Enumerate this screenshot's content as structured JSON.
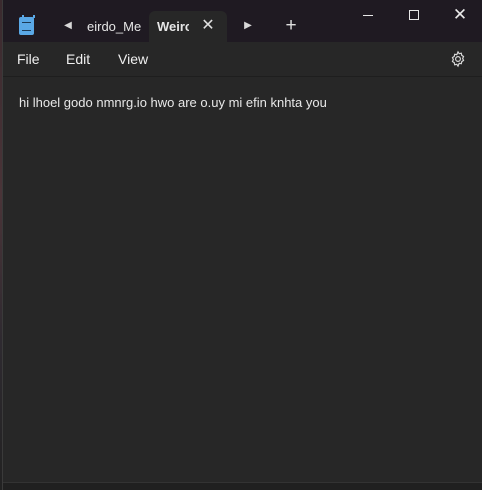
{
  "app": {
    "icon": "notepad-icon"
  },
  "tabs": [
    {
      "title": "eirdo_Me",
      "active": false
    },
    {
      "title": "Weirc",
      "active": true
    }
  ],
  "tab_controls": {
    "scroll_left_icon": "caret-left-icon",
    "scroll_right_icon": "caret-right-icon",
    "close_icon": "close-icon",
    "new_tab_icon": "plus-icon"
  },
  "window_controls": {
    "minimize_icon": "minimize-icon",
    "maximize_icon": "maximize-icon",
    "close_icon": "close-icon"
  },
  "menu": {
    "file": "File",
    "edit": "Edit",
    "view": "View",
    "settings_icon": "gear-icon"
  },
  "editor": {
    "text": "hi lhoel godo nmnrg.io hwo are o.uy mi efin knhta you"
  },
  "colors": {
    "background": "#272727",
    "titlebar": "#1f1a22",
    "accent": "#5aa8e6",
    "spellcheck": "#e04a4a"
  }
}
